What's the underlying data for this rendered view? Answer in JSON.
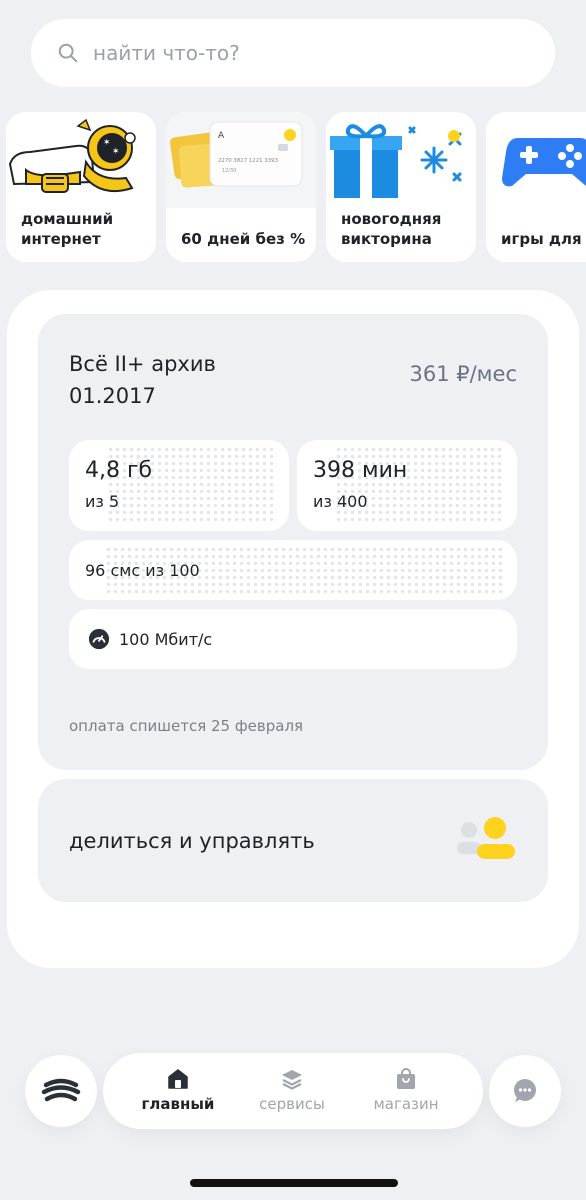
{
  "search": {
    "placeholder": "найти что-то?"
  },
  "stories": [
    {
      "label": "домашний\nинтернет"
    },
    {
      "label": "60 дней без %"
    },
    {
      "label": "новогодняя\nвикторина"
    },
    {
      "label": "игры для в"
    }
  ],
  "card_art": {
    "number": "2270 3827 1221 3393",
    "expiry": "12/30",
    "logo": "А"
  },
  "tariff": {
    "name": "Всё II+ архив\n01.2017",
    "price": "361 ₽/мес",
    "data": {
      "value": "4,8 гб",
      "of": "из 5"
    },
    "minutes": {
      "value": "398 мин",
      "of": "из 400"
    },
    "sms": "96 смс из 100",
    "speed": "100 Мбит/с",
    "payment_note": "оплата спишется 25 февраля"
  },
  "share": {
    "label": "делиться и управлять"
  },
  "pager": {
    "count": 4,
    "active": 0
  },
  "nav": {
    "home": "главный",
    "services": "сервисы",
    "shop": "магазин"
  },
  "colors": {
    "accent": "#ffd21f",
    "background": "#eef0f3",
    "text": "#1f2229",
    "muted": "#a0a5ae"
  }
}
